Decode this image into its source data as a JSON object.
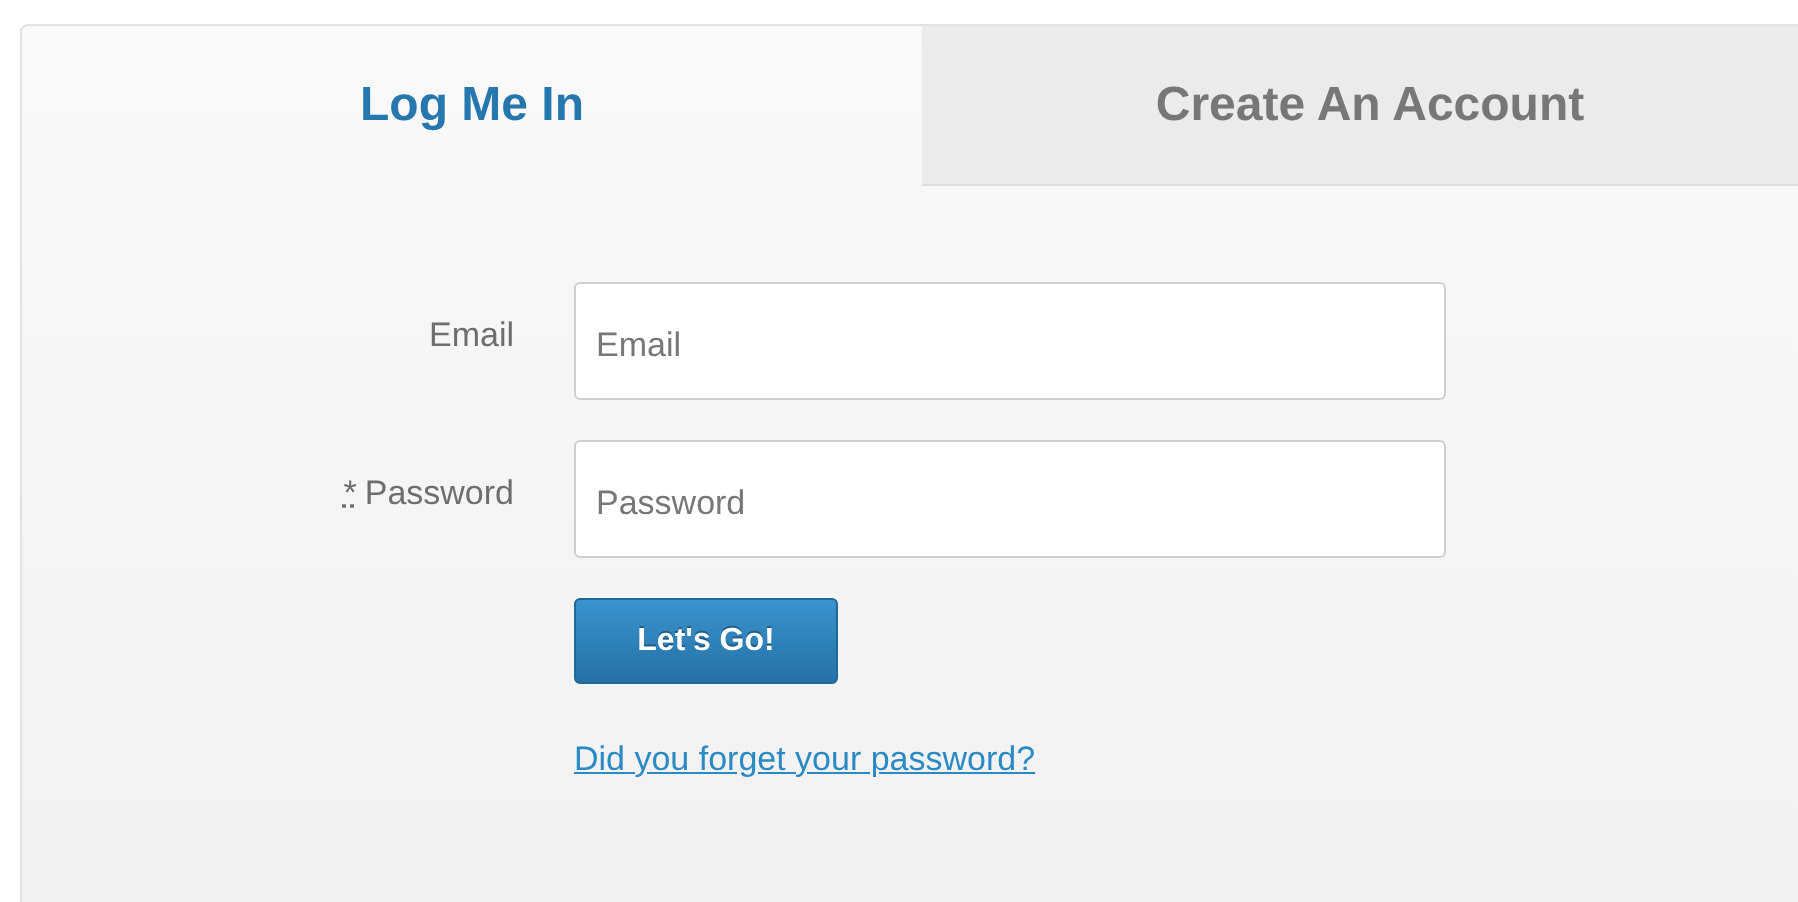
{
  "tabs": [
    {
      "label": "Log Me In",
      "selected": true
    },
    {
      "label": "Create An Account",
      "selected": false
    }
  ],
  "fields": [
    {
      "label": "Email",
      "placeholder": "Email"
    },
    {
      "label": "Password",
      "required_mark": "*",
      "placeholder": "Password"
    }
  ],
  "submit_button": "Let's Go!",
  "forgot_link": "Did you forget your password?"
}
